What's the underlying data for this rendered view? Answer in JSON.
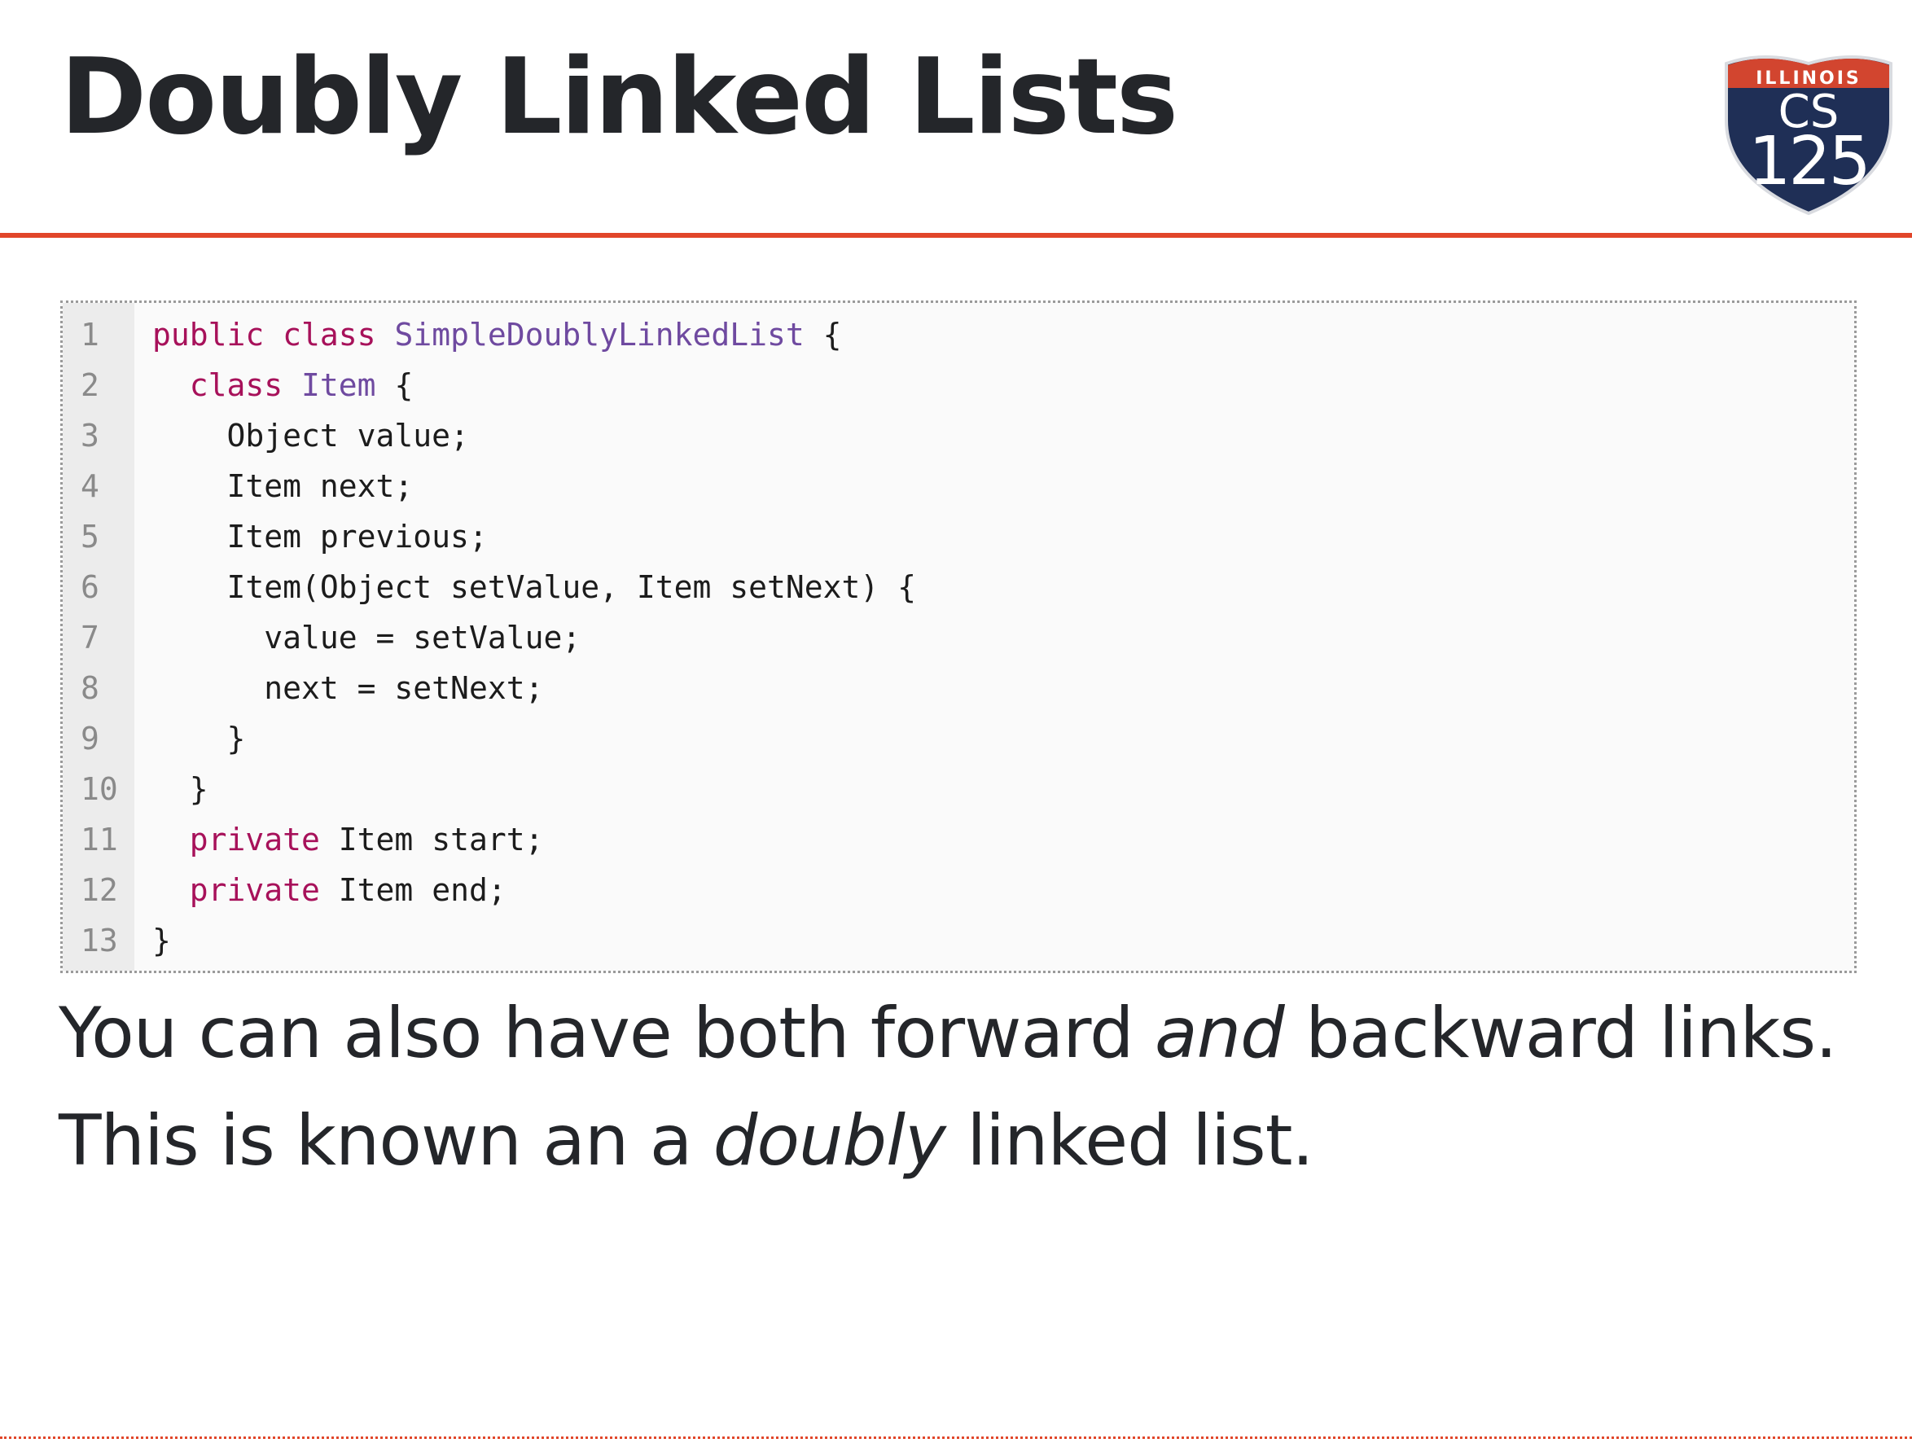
{
  "slide": {
    "title": "Doubly Linked Lists",
    "logo": {
      "top_text": "ILLINOIS",
      "course_prefix": "CS",
      "course_number": "125"
    }
  },
  "colors": {
    "accent_rule": "#e1462a",
    "keyword": "#a7115a",
    "type_name": "#6f4aa0",
    "shield_blue": "#1f2f56",
    "shield_red": "#d2452f"
  },
  "code": {
    "language": "java",
    "lines": [
      {
        "n": "1",
        "indent": "",
        "tokens": [
          {
            "t": "public class",
            "c": "kw"
          },
          {
            "t": " ",
            "c": ""
          },
          {
            "t": "SimpleDoublyLinkedList",
            "c": "ty"
          },
          {
            "t": " {",
            "c": ""
          }
        ]
      },
      {
        "n": "2",
        "indent": "  ",
        "tokens": [
          {
            "t": "class",
            "c": "kw"
          },
          {
            "t": " ",
            "c": ""
          },
          {
            "t": "Item",
            "c": "ty"
          },
          {
            "t": " {",
            "c": ""
          }
        ]
      },
      {
        "n": "3",
        "indent": "    ",
        "tokens": [
          {
            "t": "Object value;",
            "c": ""
          }
        ]
      },
      {
        "n": "4",
        "indent": "    ",
        "tokens": [
          {
            "t": "Item next;",
            "c": ""
          }
        ]
      },
      {
        "n": "5",
        "indent": "    ",
        "tokens": [
          {
            "t": "Item previous;",
            "c": ""
          }
        ]
      },
      {
        "n": "6",
        "indent": "    ",
        "tokens": [
          {
            "t": "Item(Object setValue, Item setNext) {",
            "c": ""
          }
        ]
      },
      {
        "n": "7",
        "indent": "      ",
        "tokens": [
          {
            "t": "value = setValue;",
            "c": ""
          }
        ]
      },
      {
        "n": "8",
        "indent": "      ",
        "tokens": [
          {
            "t": "next = setNext;",
            "c": ""
          }
        ]
      },
      {
        "n": "9",
        "indent": "    ",
        "tokens": [
          {
            "t": "}",
            "c": ""
          }
        ]
      },
      {
        "n": "10",
        "indent": "  ",
        "tokens": [
          {
            "t": "}",
            "c": ""
          }
        ]
      },
      {
        "n": "11",
        "indent": "  ",
        "tokens": [
          {
            "t": "private",
            "c": "kw"
          },
          {
            "t": " Item start;",
            "c": ""
          }
        ]
      },
      {
        "n": "12",
        "indent": "  ",
        "tokens": [
          {
            "t": "private",
            "c": "kw"
          },
          {
            "t": " Item end;",
            "c": ""
          }
        ]
      },
      {
        "n": "13",
        "indent": "",
        "tokens": [
          {
            "t": "}",
            "c": ""
          }
        ]
      }
    ]
  },
  "text": {
    "line1_before": "You can also have both forward ",
    "line1_em": "and",
    "line1_after": " backward links.",
    "line2_before": "This is known an a ",
    "line2_em": "doubly",
    "line2_after": " linked list."
  }
}
